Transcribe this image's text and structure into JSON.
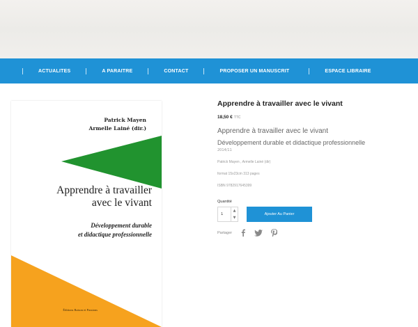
{
  "nav": {
    "items": [
      {
        "label": "ACTUALITES"
      },
      {
        "label": "A PARAITRE"
      },
      {
        "label": "CONTACT"
      },
      {
        "label": "PROPOSER UN MANUSCRIT"
      },
      {
        "label": "ESPACE LIBRAIRE"
      }
    ]
  },
  "cover": {
    "author1": "Patrick Mayen",
    "author2": "Armelle Lainé (dir.)",
    "title_line1": "Apprendre à travailler",
    "title_line2": "avec le vivant",
    "subtitle_line1": "Développement durable",
    "subtitle_line2": "et didactique professionnelle",
    "publisher": "Éditions Raison et Passions",
    "colors": {
      "green": "#21932f",
      "orange": "#f6a21e"
    }
  },
  "product": {
    "title": "Apprendre à travailler avec le vivant",
    "price": "18,50 €",
    "price_suffix": "TTC",
    "desc_title": "Apprendre à travailler avec le vivant",
    "desc_subtitle": "Développement durable et didactique professionnelle",
    "year": "2014/11",
    "authors": "Patrick Mayen , Armelle Lainé (dir)",
    "format": "format 15x23cm 313 pages",
    "isbn": "ISBN 9782917645399",
    "quantity_label": "Quantité",
    "quantity_value": "1",
    "add_to_cart": "Ajouter Au Panier",
    "share_label": "Partager"
  },
  "colors": {
    "nav_bg": "#1f92d6",
    "button_bg": "#1f92d6"
  }
}
